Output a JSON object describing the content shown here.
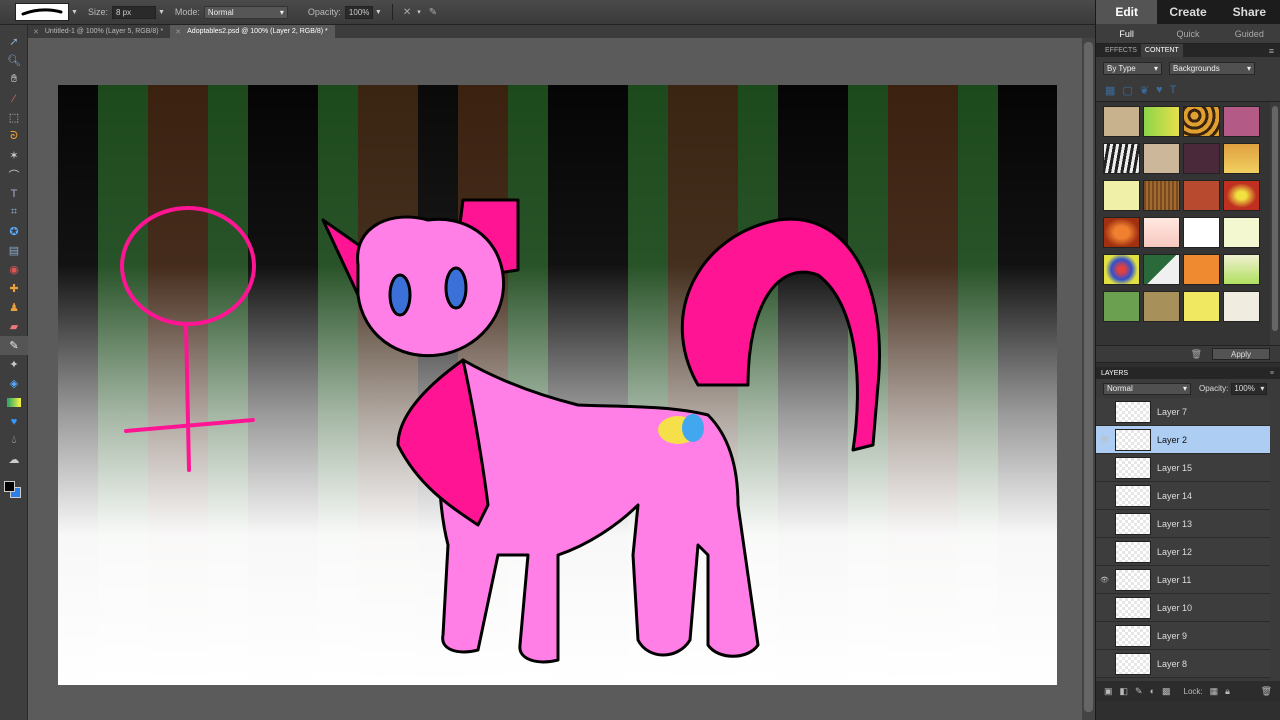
{
  "options_bar": {
    "size_label": "Size:",
    "size_value": "8 px",
    "mode_label": "Mode:",
    "mode_value": "Normal",
    "opacity_label": "Opacity:",
    "opacity_value": "100%"
  },
  "doc_tabs": [
    {
      "label": "Untitled-1 @ 100% (Layer 5, RGB/8) *"
    },
    {
      "label": "Adoptables2.psd @ 100% (Layer 2, RGB/8) *"
    }
  ],
  "panel": {
    "modes": [
      "Edit",
      "Create",
      "Share"
    ],
    "sub_modes": [
      "Full",
      "Quick",
      "Guided"
    ],
    "bin_tabs": [
      "EFFECTS",
      "CONTENT"
    ],
    "filter_by": "By Type",
    "filter_category": "Backgrounds",
    "apply_label": "Apply",
    "layers_title": "LAYERS",
    "blend_mode": "Normal",
    "opacity_label": "Opacity:",
    "opacity_value": "100%",
    "lock_label": "Lock:"
  },
  "layers": [
    {
      "name": "Layer 7",
      "visible": false
    },
    {
      "name": "Layer 2",
      "visible": true
    },
    {
      "name": "Layer 15",
      "visible": false
    },
    {
      "name": "Layer 14",
      "visible": false
    },
    {
      "name": "Layer 13",
      "visible": false
    },
    {
      "name": "Layer 12",
      "visible": false
    },
    {
      "name": "Layer 11",
      "visible": true
    },
    {
      "name": "Layer 10",
      "visible": false
    },
    {
      "name": "Layer 9",
      "visible": false
    },
    {
      "name": "Layer 8",
      "visible": false
    }
  ],
  "colors": {
    "accent_pink": "#ff1493",
    "body_pink": "#ff7fe6",
    "selection": "#aecdf2",
    "background_color": "#2c7fe8"
  },
  "icons": {
    "tools": [
      "move-icon",
      "zoom-icon",
      "hand-icon",
      "eyedropper-icon",
      "marquee-icon",
      "lasso-icon",
      "magic-wand-icon",
      "quick-selection-icon",
      "type-icon",
      "crop-icon",
      "cookie-cutter-icon",
      "straighten-icon",
      "red-eye-icon",
      "spot-healing-icon",
      "clone-stamp-icon",
      "eraser-icon",
      "brush-icon",
      "smart-brush-icon",
      "paint-bucket-icon",
      "gradient-icon",
      "shape-icon",
      "blur-icon",
      "sponge-icon"
    ]
  }
}
